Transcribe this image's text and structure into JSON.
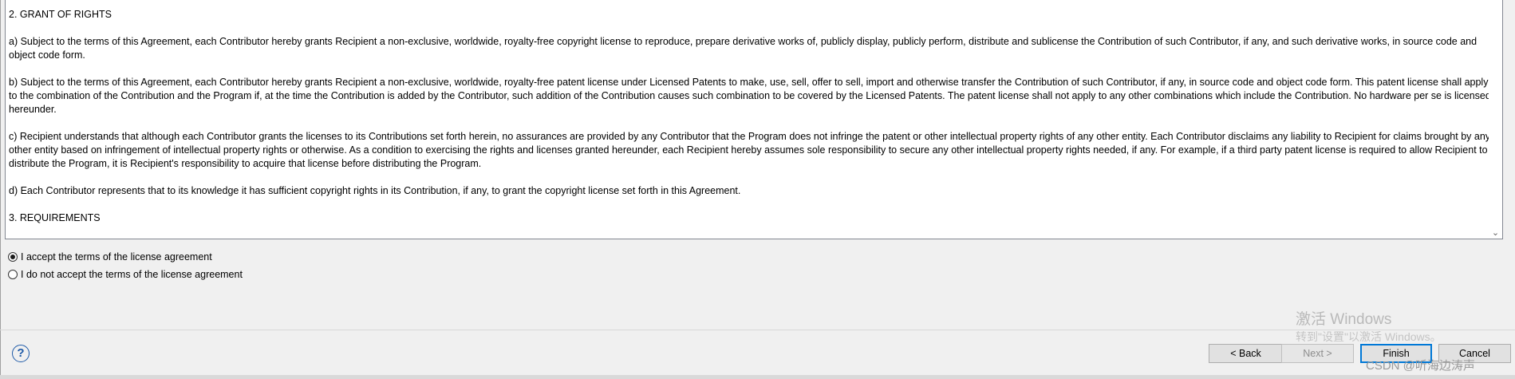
{
  "license": {
    "paragraphs": [
      "2. GRANT OF RIGHTS",
      "a) Subject to the terms of this Agreement, each Contributor hereby grants Recipient a non-exclusive, worldwide, royalty-free copyright license to reproduce, prepare derivative works of, publicly display, publicly perform, distribute and sublicense the Contribution of such Contributor, if any, and such derivative works, in source code and object code form.",
      "b) Subject to the terms of this Agreement, each Contributor hereby grants Recipient a non-exclusive, worldwide, royalty-free patent license under Licensed Patents to make, use, sell, offer to sell, import and otherwise transfer the Contribution of such Contributor, if any, in source code and object code form. This patent license shall apply to the combination of the Contribution and the Program if, at the time the Contribution is added by the Contributor, such addition of the Contribution causes such combination to be covered by the Licensed Patents. The patent license shall not apply to any other combinations which include the Contribution. No hardware per se is licensed hereunder.",
      "c) Recipient understands that although each Contributor grants the licenses to its Contributions set forth herein, no assurances are provided by any Contributor that the Program does not infringe the patent or other intellectual property rights of any other entity. Each Contributor disclaims any liability to Recipient for claims brought by any other entity based on infringement of intellectual property rights or otherwise. As a condition to exercising the rights and licenses granted hereunder, each Recipient hereby assumes sole responsibility to secure any other intellectual property rights needed, if any. For example, if a third party patent license is required to allow Recipient to distribute the Program, it is Recipient's responsibility to acquire that license before distributing the Program.",
      "d) Each Contributor represents that to its knowledge it has sufficient copyright rights in its Contribution, if any, to grant the copyright license set forth in this Agreement.",
      "3. REQUIREMENTS"
    ]
  },
  "options": {
    "accept_label": "I accept the terms of the license agreement",
    "decline_label": "I do not accept the terms of the license agreement",
    "selected": "accept"
  },
  "buttons": {
    "back": "< Back",
    "next": "Next >",
    "finish": "Finish",
    "cancel": "Cancel"
  },
  "icons": {
    "help": "help-icon",
    "scroll_down": "chevron-down-icon"
  },
  "watermarks": {
    "activate_title": "激活 Windows",
    "activate_sub": "转到\"设置\"以激活 Windows。",
    "csdn": "CSDN @听海边涛声"
  },
  "colors": {
    "default_button_border": "#0078d7",
    "help_icon": "#1e5aa8"
  }
}
